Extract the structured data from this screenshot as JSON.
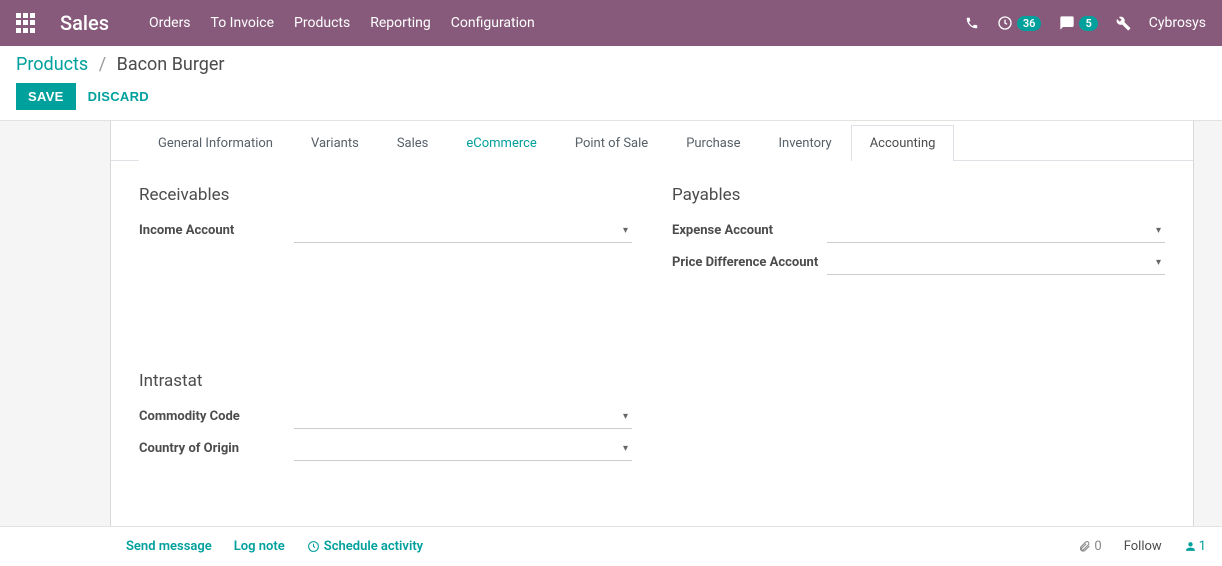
{
  "topbar": {
    "brand": "Sales",
    "menu": [
      "Orders",
      "To Invoice",
      "Products",
      "Reporting",
      "Configuration"
    ],
    "phone_icon": "phone",
    "clock_badge": "36",
    "chat_badge": "5",
    "user": "Cybrosys"
  },
  "breadcrumb": {
    "root": "Products",
    "current": "Bacon Burger"
  },
  "buttons": {
    "save": "SAVE",
    "discard": "DISCARD"
  },
  "tabs": [
    {
      "label": "General Information",
      "state": ""
    },
    {
      "label": "Variants",
      "state": ""
    },
    {
      "label": "Sales",
      "state": ""
    },
    {
      "label": "eCommerce",
      "state": "eco"
    },
    {
      "label": "Point of Sale",
      "state": ""
    },
    {
      "label": "Purchase",
      "state": ""
    },
    {
      "label": "Inventory",
      "state": ""
    },
    {
      "label": "Accounting",
      "state": "active"
    }
  ],
  "sections": {
    "receivables": {
      "title": "Receivables",
      "fields": {
        "income_account": "Income Account"
      }
    },
    "intrastat": {
      "title": "Intrastat",
      "fields": {
        "commodity_code": "Commodity Code",
        "country_origin": "Country of Origin"
      }
    },
    "payables": {
      "title": "Payables",
      "fields": {
        "expense_account": "Expense Account",
        "price_diff": "Price Difference Account"
      }
    }
  },
  "chatter": {
    "send": "Send message",
    "log": "Log note",
    "schedule": "Schedule activity",
    "attach_count": "0",
    "follow": "Follow",
    "followers": "1"
  }
}
